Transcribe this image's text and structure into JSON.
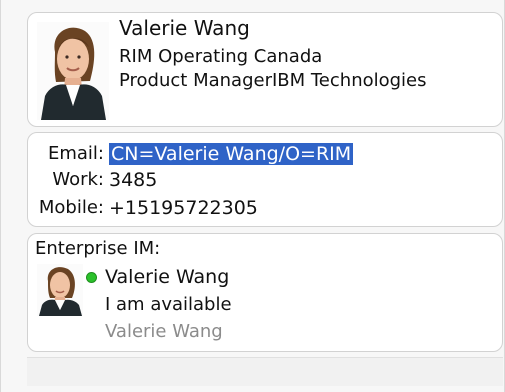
{
  "contact": {
    "name": "Valerie Wang",
    "company": "RIM Operating Canada",
    "title_company": "Product ManagerIBM Technologies"
  },
  "details": {
    "email_label": "Email:",
    "email_value": "CN=Valerie Wang/O=RIM",
    "work_label": "Work:",
    "work_value": "3485",
    "mobile_label": "Mobile:",
    "mobile_value": "+15195722305"
  },
  "enterprise_im": {
    "title": "Enterprise IM:",
    "name": "Valerie Wang",
    "status": "I am available",
    "display_name": "Valerie Wang",
    "status_color": "#2bc12b"
  },
  "icons": {
    "avatar": "person-photo-icon",
    "presence": "available-status-icon"
  }
}
